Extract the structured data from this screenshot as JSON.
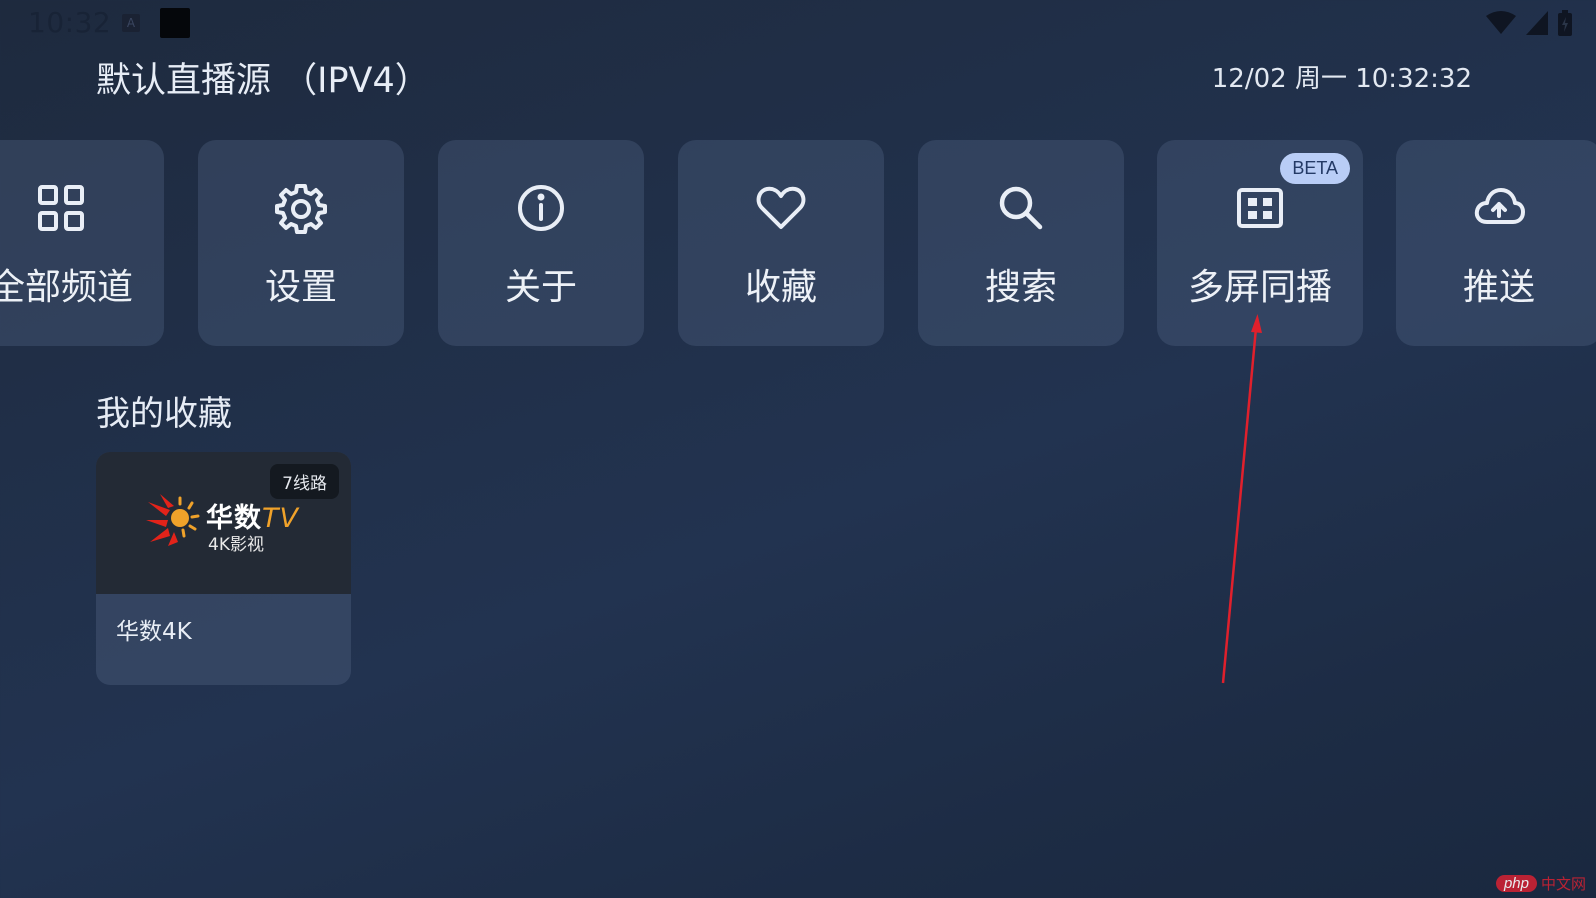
{
  "status_bar": {
    "time": "10:32",
    "notification_glyph": "A",
    "icons": [
      "a-box-icon",
      "black-square-icon",
      "wifi-icon",
      "signal-icon",
      "battery-icon"
    ]
  },
  "header": {
    "title": "默认直播源 （IPV4）",
    "datetime": "12/02 周一 10:32:32"
  },
  "tiles": [
    {
      "label": "全部频道",
      "icon": "grid-icon"
    },
    {
      "label": "设置",
      "icon": "gear-icon"
    },
    {
      "label": "关于",
      "icon": "info-icon"
    },
    {
      "label": "收藏",
      "icon": "heart-icon"
    },
    {
      "label": "搜索",
      "icon": "search-icon"
    },
    {
      "label": "多屏同播",
      "icon": "multiscreen-icon",
      "badge": "BETA"
    },
    {
      "label": "推送",
      "icon": "cloud-upload-icon"
    }
  ],
  "favorites": {
    "title": "我的收藏",
    "items": [
      {
        "name": "华数4K",
        "badge": "7线路",
        "logo": {
          "brand": "华数",
          "brand_tv": "TV",
          "subtitle": "4K影视"
        }
      }
    ]
  },
  "annotation": {
    "arrow_color": "#e0202c"
  },
  "watermark": {
    "php": "php",
    "site": "中文网"
  },
  "colors": {
    "background": "#1f2e47",
    "tile_bg": "#3d4d68",
    "badge_bg": "#b9cdf6",
    "logo_red": "#e2231a",
    "logo_orange": "#f0a22a"
  }
}
